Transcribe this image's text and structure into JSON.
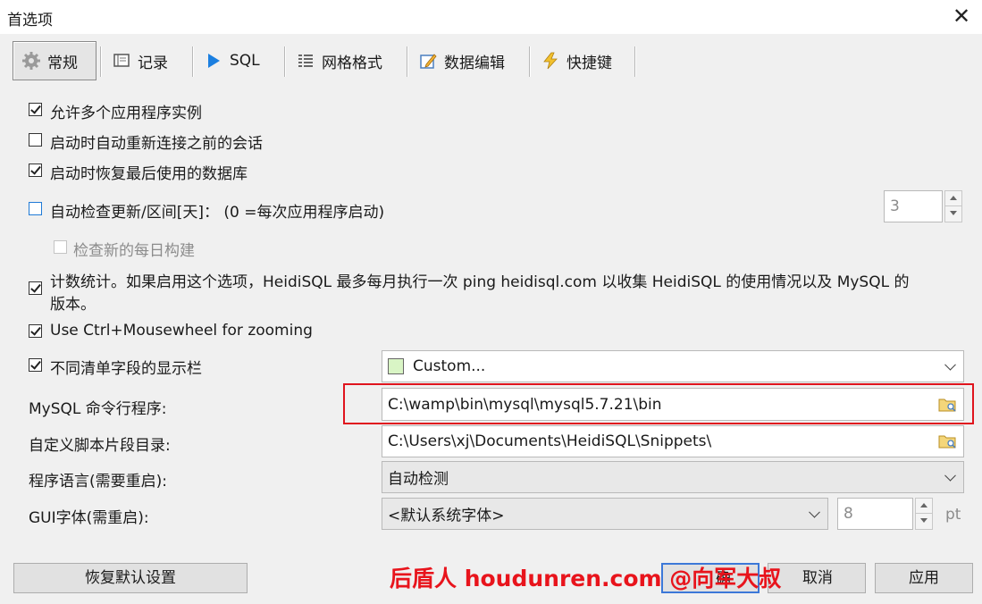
{
  "window": {
    "title": "首选项",
    "close_glyph": "✕"
  },
  "tabs": [
    {
      "label": "常规",
      "icon": "gear-icon"
    },
    {
      "label": "记录",
      "icon": "log-icon"
    },
    {
      "label": "SQL",
      "icon": "play-icon"
    },
    {
      "label": "网格格式",
      "icon": "grid-icon"
    },
    {
      "label": "数据编辑",
      "icon": "edit-icon"
    },
    {
      "label": "快捷键",
      "icon": "lightning-icon"
    }
  ],
  "options": {
    "multi_instance": {
      "label": "允许多个应用程序实例",
      "checked": true
    },
    "reconnect": {
      "label": "启动时自动重新连接之前的会话",
      "checked": false
    },
    "restore_db": {
      "label": "启动时恢复最后使用的数据库",
      "checked": true
    },
    "auto_update": {
      "label": "自动检查更新/区间[天]：  (0 =每次应用程序启动)",
      "checked": false,
      "value": "3"
    },
    "daily_build": {
      "label": "检查新的每日构建",
      "checked": false
    },
    "stats_line1": "计数统计。如果启用这个选项，HeidiSQL 最多每月执行一次 ping heidisql.com 以收集 HeidiSQL 的使用情况以及 MySQL 的",
    "stats_line2": "版本。",
    "stats_checked": true,
    "ctrl_wheel": {
      "label": "Use Ctrl+Mousewheel for zooming",
      "checked": true
    },
    "field_colors": {
      "label": "不同清单字段的显示栏",
      "checked": true,
      "value": "Custom...",
      "swatch": "#d9f5c5"
    }
  },
  "settings": {
    "mysql_label": "MySQL 命令行程序:",
    "mysql_path": "C:\\wamp\\bin\\mysql\\mysql5.7.21\\bin",
    "snippets_label": "自定义脚本片段目录:",
    "snippets_path": "C:\\Users\\xj\\Documents\\HeidiSQL\\Snippets\\",
    "lang_label": "程序语言(需要重启):",
    "lang_value": "自动检测",
    "font_label": "GUI字体(需重启):",
    "font_value": "<默认系统字体>",
    "font_size": "8",
    "font_unit": "pt"
  },
  "buttons": {
    "restore_defaults": "恢复默认设置",
    "ok_partial": "确",
    "cancel_partial": "取消",
    "apply": "应用"
  },
  "watermark": "后盾人 houdunren.com @向军大叔",
  "colors": {
    "accent_red": "#e0141e",
    "checkbox_blue": "#1f7ad6"
  }
}
